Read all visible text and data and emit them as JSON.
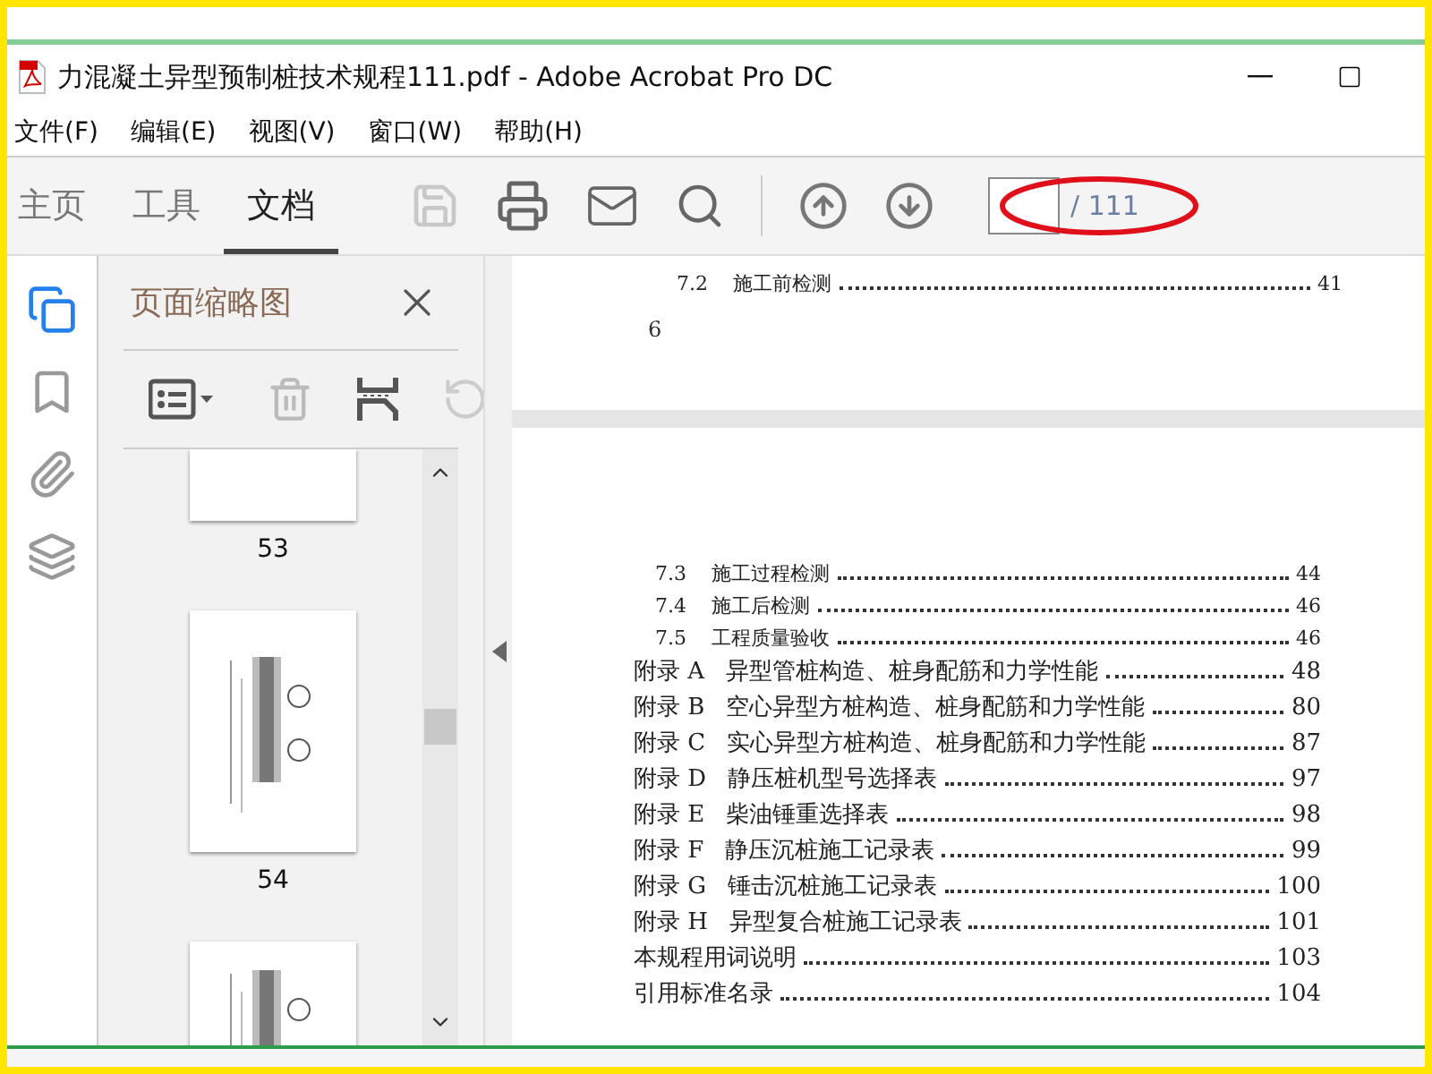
{
  "window": {
    "title": "力混凝土异型预制桩技术规程111.pdf - Adobe Acrobat Pro DC"
  },
  "menu": [
    "文件(F)",
    "编辑(E)",
    "视图(V)",
    "窗口(W)",
    "帮助(H)"
  ],
  "tabs": [
    {
      "label": "主页",
      "selected": false
    },
    {
      "label": "工具",
      "selected": false
    },
    {
      "label": "文档",
      "selected": true
    }
  ],
  "toolbar": {
    "save_disabled": true,
    "page_total": "/ 111"
  },
  "side_rail": [
    {
      "kind": "pages",
      "selected": true
    },
    {
      "kind": "bookmarks",
      "selected": false
    },
    {
      "kind": "attachments",
      "selected": false
    },
    {
      "kind": "layers",
      "selected": false
    }
  ],
  "thumbnail_panel": {
    "title": "页面缩略图",
    "thumbnails": [
      {
        "label": "53",
        "kind": "blank"
      },
      {
        "label": "54",
        "kind": "drawing"
      },
      {
        "kind": "drawing"
      }
    ]
  },
  "document": {
    "page_top": {
      "entries": [
        {
          "kind": "section",
          "number": "7.2",
          "title": "施工前检测",
          "page": "41"
        }
      ],
      "footer": "6"
    },
    "page_bottom": {
      "entries": [
        {
          "kind": "section",
          "number": "7.3",
          "title": "施工过程检测",
          "page": "44"
        },
        {
          "kind": "section",
          "number": "7.4",
          "title": "施工后检测",
          "page": "46"
        },
        {
          "kind": "section",
          "number": "7.5",
          "title": "工程质量验收",
          "page": "46"
        },
        {
          "kind": "appendix",
          "number": "附录 A",
          "title": "异型管桩构造、桩身配筋和力学性能",
          "page": "48"
        },
        {
          "kind": "appendix",
          "number": "附录 B",
          "title": "空心异型方桩构造、桩身配筋和力学性能",
          "page": "80"
        },
        {
          "kind": "appendix",
          "number": "附录 C",
          "title": "实心异型方桩构造、桩身配筋和力学性能",
          "page": "87"
        },
        {
          "kind": "appendix",
          "number": "附录 D",
          "title": "静压桩机型号选择表",
          "page": "97"
        },
        {
          "kind": "appendix",
          "number": "附录 E",
          "title": "柴油锤重选择表",
          "page": "98"
        },
        {
          "kind": "appendix",
          "number": "附录 F",
          "title": "静压沉桩施工记录表",
          "page": "99"
        },
        {
          "kind": "appendix",
          "number": "附录 G",
          "title": "锤击沉桩施工记录表",
          "page": "100"
        },
        {
          "kind": "appendix",
          "number": "附录 H",
          "title": "异型复合桩施工记录表",
          "page": "101"
        },
        {
          "kind": "plain",
          "title": "本规程用词说明",
          "page": "103"
        },
        {
          "kind": "plain",
          "title": "引用标准名录",
          "page": "104"
        }
      ]
    }
  }
}
